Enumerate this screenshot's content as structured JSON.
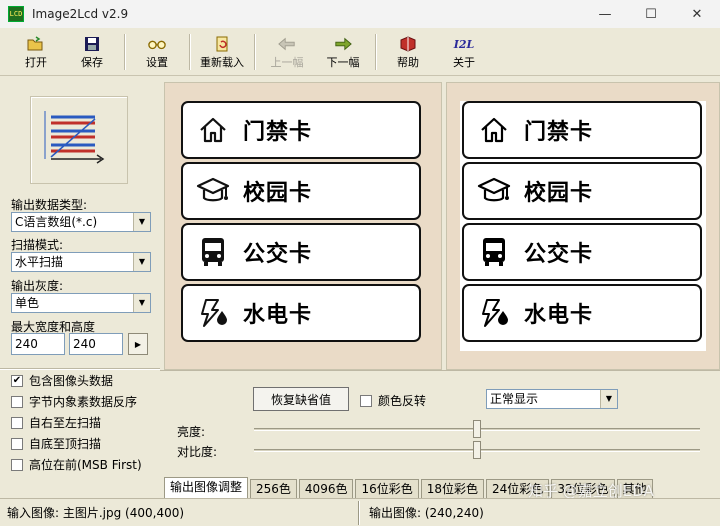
{
  "window": {
    "title": "Image2Lcd v2.9",
    "icon_text": "LCD",
    "controls": {
      "minimize": "—",
      "maximize": "☐",
      "close": "✕"
    }
  },
  "toolbar": {
    "open": "打开",
    "save": "保存",
    "settings": "设置",
    "reload": "重新载入",
    "prev": "上一幅",
    "next": "下一幅",
    "help": "帮助",
    "about": "关于",
    "about_icon_text": "I2L"
  },
  "left_panel": {
    "output_type_label": "输出数据类型:",
    "output_type_value": "C语言数组(*.c)",
    "scan_mode_label": "扫描模式:",
    "scan_mode_value": "水平扫描",
    "gray_label": "输出灰度:",
    "gray_value": "单色",
    "max_size_label": "最大宽度和高度",
    "max_width": "240",
    "max_height": "240",
    "options": [
      {
        "label": "包含图像头数据",
        "checked": true
      },
      {
        "label": "字节内象素数据反序",
        "checked": false
      },
      {
        "label": "自右至左扫描",
        "checked": false
      },
      {
        "label": "自底至顶扫描",
        "checked": false
      },
      {
        "label": "高位在前(MSB First)",
        "checked": false
      }
    ]
  },
  "preview": {
    "cards": [
      {
        "icon": "home-icon",
        "text": "门禁卡"
      },
      {
        "icon": "graduation-cap-icon",
        "text": "校园卡"
      },
      {
        "icon": "bus-icon",
        "text": "公交卡"
      },
      {
        "icon": "water-electric-icon",
        "text": "水电卡"
      }
    ]
  },
  "adjust": {
    "restore_default": "恢复缺省值",
    "invert_label": "颜色反转",
    "display_mode": "正常显示",
    "brightness_label": "亮度:",
    "contrast_label": "对比度:",
    "brightness_value": 0.5,
    "contrast_value": 0.5,
    "tabs": [
      "输出图像调整",
      "256色",
      "4096色",
      "16位彩色",
      "18位彩色",
      "24位彩色",
      "32位彩色",
      "其他"
    ]
  },
  "status": {
    "input_image": "输入图像: 主图片.jpg (400,400)",
    "output_image": "输出图像: (240,240)"
  },
  "watermark": "知乎 @嘉立创EDA"
}
